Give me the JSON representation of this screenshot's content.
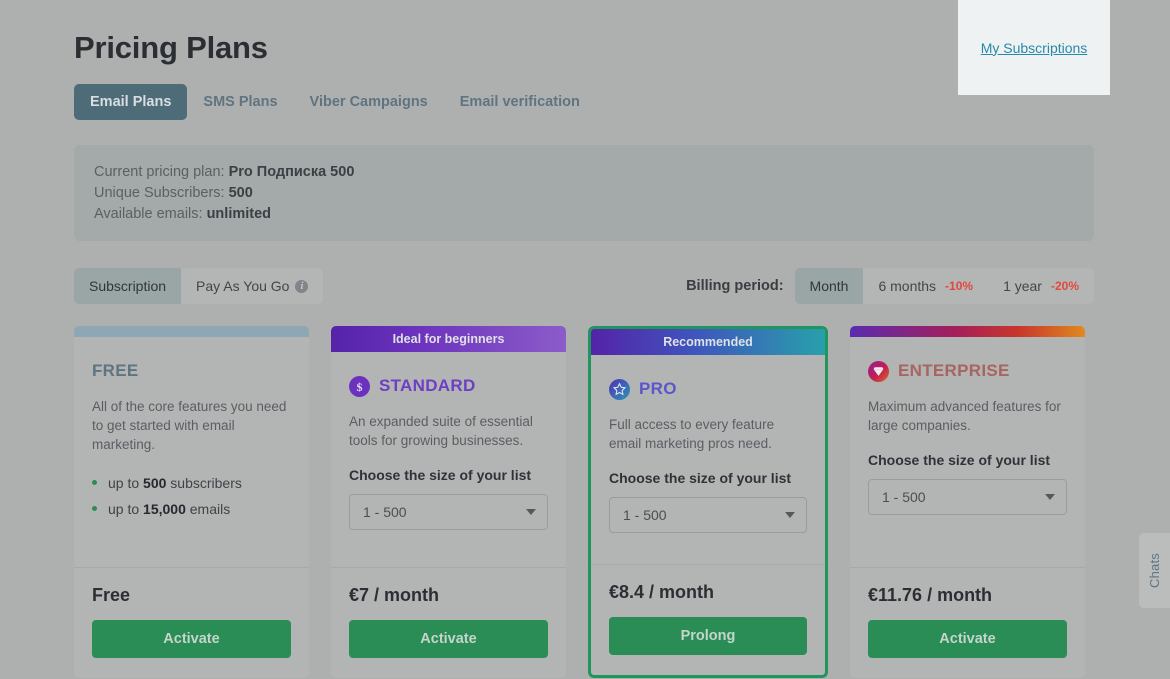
{
  "header": {
    "title": "Pricing Plans",
    "tabs": [
      {
        "label": "Email Plans",
        "active": true
      },
      {
        "label": "SMS Plans",
        "active": false
      },
      {
        "label": "Viber Campaigns",
        "active": false
      },
      {
        "label": "Email verification",
        "active": false
      }
    ]
  },
  "subscriptions_panel": {
    "link_label": "My Subscriptions"
  },
  "current_plan": {
    "plan_label": "Current pricing plan:",
    "plan_value": "Pro Подписка 500",
    "subscribers_label": "Unique Subscribers:",
    "subscribers_value": "500",
    "emails_label": "Available emails:",
    "emails_value": "unlimited"
  },
  "controls": {
    "mode": {
      "options": [
        {
          "label": "Subscription",
          "active": true,
          "info": false
        },
        {
          "label": "Pay As You Go",
          "active": false,
          "info": true,
          "info_glyph": "i"
        }
      ]
    },
    "billing": {
      "label": "Billing period:",
      "options": [
        {
          "label": "Month",
          "discount": "",
          "active": true
        },
        {
          "label": "6 months",
          "discount": "-10%",
          "active": false
        },
        {
          "label": "1 year",
          "discount": "-20%",
          "active": false
        }
      ]
    }
  },
  "plans": [
    {
      "id": "free",
      "ribbon": "",
      "accent_css": "#8fa7b5",
      "name": "FREE",
      "name_class": "free",
      "icon": "none",
      "description": "All of the core features you need to get started with email marketing.",
      "choose_label": "",
      "select_value": "",
      "features": [
        {
          "prefix": "up to ",
          "value": "500",
          "suffix": " subscribers"
        },
        {
          "prefix": "up to ",
          "value": "15,000",
          "suffix": " emails"
        }
      ],
      "price": "Free",
      "cta": "Activate",
      "highlight": false
    },
    {
      "id": "standard",
      "ribbon": "Ideal for beginners",
      "accent_css": "linear-gradient(90deg,#5423a8 0%,#6b32bd 35%,#8c5cc9 100%)",
      "name": "STANDARD",
      "name_class": "std",
      "icon": "dollar-badge-icon",
      "description": "An expanded suite of essential tools for growing businesses.",
      "choose_label": "Choose the size of your list",
      "select_value": "1 - 500",
      "features": [],
      "price": "€7 / month",
      "cta": "Activate",
      "highlight": false
    },
    {
      "id": "pro",
      "ribbon": "Recommended",
      "accent_css": "linear-gradient(90deg,#5423a8 0%,#3f56bd 45%,#28a0ab 100%)",
      "name": "PRO",
      "name_class": "pro",
      "icon": "star-badge-icon",
      "description": "Full access to every feature email marketing pros need.",
      "choose_label": "Choose the size of your list",
      "select_value": "1 - 500",
      "features": [],
      "price": "€8.4 / month",
      "cta": "Prolong",
      "highlight": true
    },
    {
      "id": "enterprise",
      "ribbon": "",
      "accent_css": "linear-gradient(90deg,#5a2bb0 0%,#a51f5a 45%,#c8372c 72%,#e08a1e 100%)",
      "name": "ENTERPRISE",
      "name_class": "ent",
      "icon": "diamond-badge-icon",
      "description": "Maximum advanced features for large companies.",
      "choose_label": "Choose the size of your list",
      "select_value": "1 - 500",
      "features": [],
      "price": "€11.76 / month",
      "cta": "Activate",
      "highlight": false
    }
  ],
  "chats_widget": {
    "label": "Chats"
  }
}
